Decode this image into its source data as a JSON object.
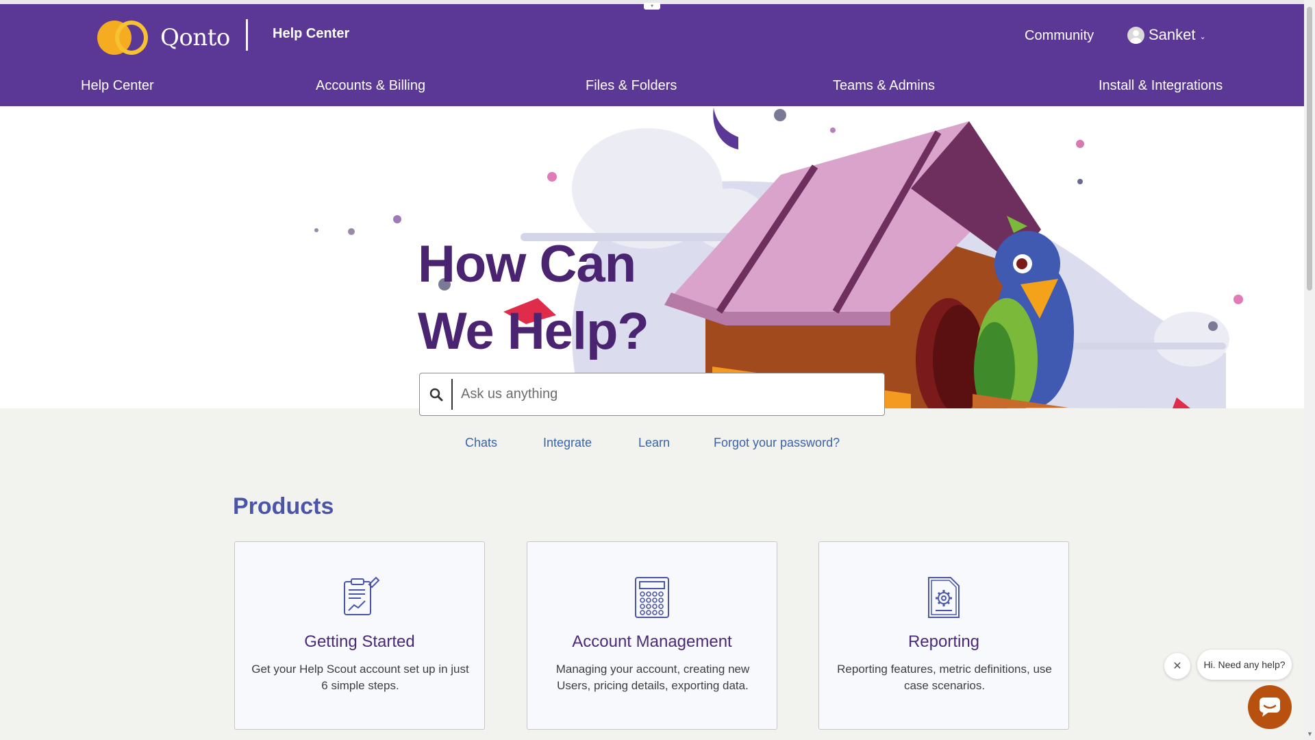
{
  "header": {
    "brand": "Qonto",
    "help_center_title": "Help Center",
    "community_label": "Community",
    "user_name": "Sanket",
    "user_caret": "⌄"
  },
  "nav": {
    "items": [
      {
        "label": "Help Center"
      },
      {
        "label": "Accounts & Billing"
      },
      {
        "label": "Files & Folders"
      },
      {
        "label": "Teams & Admins"
      },
      {
        "label": "Install & Integrations"
      }
    ]
  },
  "hero": {
    "title_line1": "How Can",
    "title_line2": "We Help?"
  },
  "search": {
    "placeholder": "Ask us anything",
    "value": ""
  },
  "quick_links": [
    {
      "label": "Chats"
    },
    {
      "label": "Integrate"
    },
    {
      "label": "Learn"
    },
    {
      "label": "Forgot your password?"
    }
  ],
  "products": {
    "title": "Products",
    "cards": [
      {
        "title": "Getting Started",
        "description": "Get your Help Scout account set up in just 6 simple steps.",
        "icon": "clipboard-chart-icon"
      },
      {
        "title": "Account Management",
        "description": "Managing your account, creating new Users, pricing details, exporting data.",
        "icon": "calculator-icon"
      },
      {
        "title": "Reporting",
        "description": "Reporting features, metric definitions, use case scenarios.",
        "icon": "document-gear-icon"
      }
    ]
  },
  "chat": {
    "bubble_text": "Hi. Need any help?",
    "close_symbol": "✕"
  },
  "colors": {
    "header_bg": "#5b3796",
    "hero_title": "#4a2470",
    "link": "#3a64a6",
    "chat_launcher": "#b85110",
    "logo_yellow": "#f6ac20"
  }
}
